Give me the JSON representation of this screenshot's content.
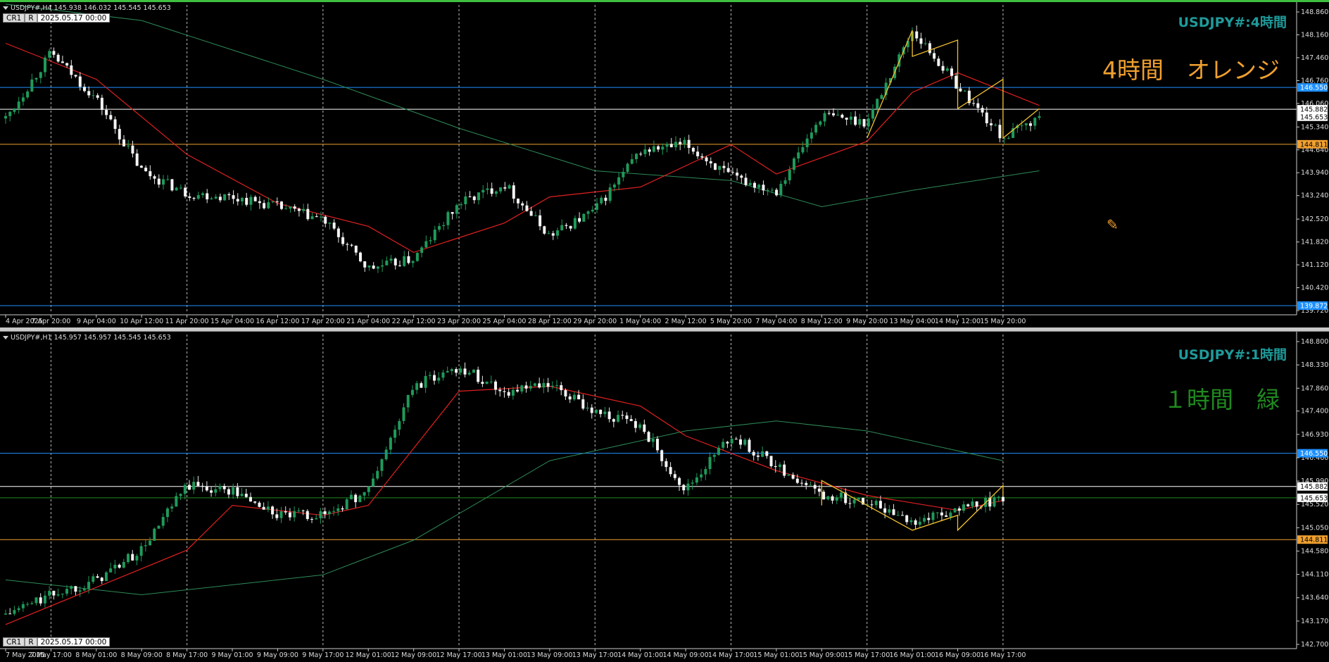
{
  "panes": [
    {
      "id": "h4",
      "info_text": "USDJPY#,H4  145.938 146.032 145.545 145.653",
      "date_flag": "2025.05.17 00:00",
      "cr_label": "CR1",
      "r_label": "R",
      "symbol_label": "USDJPY#:4時間",
      "note": "4時間　オレンジ",
      "note_color": "#f0a030",
      "price_axis": [
        "148.860",
        "148.160",
        "147.460",
        "146.760",
        "146.060",
        "145.340",
        "144.640",
        "143.940",
        "143.240",
        "142.520",
        "141.820",
        "141.120",
        "140.420",
        "139.720"
      ],
      "price_tags": [
        {
          "label": "146.550",
          "value": 146.55,
          "bg": "#1e90ff",
          "fg": "#fff"
        },
        {
          "label": "145.882",
          "value": 145.882,
          "bg": "#ffffff",
          "fg": "#000"
        },
        {
          "label": "145.653",
          "value": 145.653,
          "bg": "#ffffff",
          "fg": "#000"
        },
        {
          "label": "144.811",
          "value": 144.811,
          "bg": "#f0a030",
          "fg": "#000"
        },
        {
          "label": "139.872",
          "value": 139.872,
          "bg": "#1e90ff",
          "fg": "#fff"
        }
      ],
      "time_axis": [
        "4 Apr 2025",
        "7 Apr 20:00",
        "9 Apr 04:00",
        "10 Apr 12:00",
        "11 Apr 20:00",
        "15 Apr 04:00",
        "16 Apr 12:00",
        "17 Apr 20:00",
        "21 Apr 04:00",
        "22 Apr 12:00",
        "23 Apr 20:00",
        "25 Apr 04:00",
        "28 Apr 12:00",
        "29 Apr 20:00",
        "1 May 04:00",
        "2 May 12:00",
        "5 May 20:00",
        "7 May 04:00",
        "8 May 12:00",
        "9 May 20:00",
        "13 May 04:00",
        "14 May 12:00",
        "15 May 20:00"
      ]
    },
    {
      "id": "h1",
      "info_text": "USDJPY#,H1  145.957 145.957 145.545 145.653",
      "date_flag": "2025.05.17 00:00",
      "cr_label": "CR1",
      "r_label": "R",
      "symbol_label": "USDJPY#:1時間",
      "note": "１時間　緑",
      "note_color": "#1f8a1f",
      "price_axis": [
        "148.800",
        "148.330",
        "147.860",
        "147.400",
        "146.930",
        "146.460",
        "145.990",
        "145.520",
        "145.050",
        "144.580",
        "144.110",
        "143.640",
        "143.170",
        "142.700"
      ],
      "price_tags": [
        {
          "label": "146.550",
          "value": 146.55,
          "bg": "#1e90ff",
          "fg": "#fff"
        },
        {
          "label": "145.882",
          "value": 145.882,
          "bg": "#ffffff",
          "fg": "#000"
        },
        {
          "label": "145.653",
          "value": 145.653,
          "bg": "#ffffff",
          "fg": "#000"
        },
        {
          "label": "144.811",
          "value": 144.811,
          "bg": "#f0a030",
          "fg": "#000"
        }
      ],
      "time_axis": [
        "7 May 2025",
        "7 May 17:00",
        "8 May 01:00",
        "8 May 09:00",
        "8 May 17:00",
        "9 May 01:00",
        "9 May 09:00",
        "9 May 17:00",
        "12 May 01:00",
        "12 May 09:00",
        "12 May 17:00",
        "13 May 01:00",
        "13 May 09:00",
        "13 May 17:00",
        "14 May 01:00",
        "14 May 09:00",
        "14 May 17:00",
        "15 May 01:00",
        "15 May 09:00",
        "15 May 17:00",
        "16 May 01:00",
        "16 May 09:00",
        "16 May 17:00"
      ]
    }
  ],
  "chart_data": [
    {
      "type": "candlestick",
      "title": "USDJPY#,H4",
      "ylim": [
        139.72,
        148.86
      ],
      "horizontal_levels": [
        {
          "value": 146.55,
          "color": "#1e90ff"
        },
        {
          "value": 145.882,
          "color": "#ffffff"
        },
        {
          "value": 144.811,
          "color": "#f0a030"
        },
        {
          "value": 139.872,
          "color": "#1e90ff"
        }
      ],
      "close_path": [
        {
          "x": "4 Apr 2025",
          "y": 145.6
        },
        {
          "x": "7 Apr 20:00",
          "y": 147.6
        },
        {
          "x": "9 Apr 04:00",
          "y": 146.2
        },
        {
          "x": "10 Apr 12:00",
          "y": 144.0
        },
        {
          "x": "11 Apr 20:00",
          "y": 143.3
        },
        {
          "x": "15 Apr 04:00",
          "y": 143.2
        },
        {
          "x": "16 Apr 12:00",
          "y": 142.9
        },
        {
          "x": "17 Apr 20:00",
          "y": 142.5
        },
        {
          "x": "21 Apr 04:00",
          "y": 141.0
        },
        {
          "x": "22 Apr 12:00",
          "y": 141.3
        },
        {
          "x": "23 Apr 20:00",
          "y": 143.0
        },
        {
          "x": "25 Apr 04:00",
          "y": 143.6
        },
        {
          "x": "28 Apr 12:00",
          "y": 142.0
        },
        {
          "x": "29 Apr 20:00",
          "y": 142.8
        },
        {
          "x": "1 May 04:00",
          "y": 144.6
        },
        {
          "x": "2 May 12:00",
          "y": 144.8
        },
        {
          "x": "5 May 20:00",
          "y": 143.8
        },
        {
          "x": "7 May 04:00",
          "y": 143.4
        },
        {
          "x": "8 May 12:00",
          "y": 145.7
        },
        {
          "x": "9 May 20:00",
          "y": 145.5
        },
        {
          "x": "13 May 04:00",
          "y": 148.3
        },
        {
          "x": "14 May 12:00",
          "y": 146.6
        },
        {
          "x": "15 May 20:00",
          "y": 145.0
        },
        {
          "x": "16 May 20:00",
          "y": 145.653
        }
      ],
      "ma_red": [
        {
          "x": "4 Apr 2025",
          "y": 147.9
        },
        {
          "x": "9 Apr 04:00",
          "y": 146.8
        },
        {
          "x": "11 Apr 20:00",
          "y": 144.5
        },
        {
          "x": "16 Apr 12:00",
          "y": 143.0
        },
        {
          "x": "21 Apr 04:00",
          "y": 142.3
        },
        {
          "x": "22 Apr 12:00",
          "y": 141.5
        },
        {
          "x": "25 Apr 04:00",
          "y": 142.4
        },
        {
          "x": "28 Apr 12:00",
          "y": 143.2
        },
        {
          "x": "1 May 04:00",
          "y": 143.5
        },
        {
          "x": "5 May 20:00",
          "y": 144.8
        },
        {
          "x": "7 May 04:00",
          "y": 143.9
        },
        {
          "x": "9 May 20:00",
          "y": 144.9
        },
        {
          "x": "13 May 04:00",
          "y": 146.4
        },
        {
          "x": "14 May 12:00",
          "y": 147.0
        },
        {
          "x": "16 May 20:00",
          "y": 146.0
        }
      ],
      "ma_green": [
        {
          "x": "4 Apr 2025",
          "y": 149.1
        },
        {
          "x": "10 Apr 12:00",
          "y": 148.6
        },
        {
          "x": "17 Apr 20:00",
          "y": 146.8
        },
        {
          "x": "23 Apr 20:00",
          "y": 145.3
        },
        {
          "x": "29 Apr 20:00",
          "y": 144.0
        },
        {
          "x": "5 May 20:00",
          "y": 143.7
        },
        {
          "x": "8 May 12:00",
          "y": 142.9
        },
        {
          "x": "13 May 04:00",
          "y": 143.4
        },
        {
          "x": "16 May 20:00",
          "y": 144.0
        }
      ],
      "zigzag": [
        {
          "x": "9 May 20:00",
          "y": 145.0
        },
        {
          "x": "13 May 04:00",
          "y": 148.3
        },
        {
          "x": "13 May 04:00",
          "y": 147.5
        },
        {
          "x": "14 May 12:00",
          "y": 148.0
        },
        {
          "x": "14 May 12:00",
          "y": 145.9
        },
        {
          "x": "15 May 20:00",
          "y": 146.8
        },
        {
          "x": "15 May 20:00",
          "y": 145.0
        },
        {
          "x": "16 May 20:00",
          "y": 145.9
        }
      ]
    },
    {
      "type": "candlestick",
      "title": "USDJPY#,H1",
      "ylim": [
        142.7,
        148.8
      ],
      "horizontal_levels": [
        {
          "value": 146.55,
          "color": "#1e90ff"
        },
        {
          "value": 145.882,
          "color": "#ffffff"
        },
        {
          "value": 145.653,
          "color": "#1f8a1f"
        },
        {
          "value": 144.811,
          "color": "#f0a030"
        }
      ],
      "close_path": [
        {
          "x": "7 May 2025",
          "y": 143.3
        },
        {
          "x": "7 May 17:00",
          "y": 143.7
        },
        {
          "x": "8 May 01:00",
          "y": 144.0
        },
        {
          "x": "8 May 09:00",
          "y": 144.6
        },
        {
          "x": "8 May 17:00",
          "y": 145.9
        },
        {
          "x": "9 May 01:00",
          "y": 145.8
        },
        {
          "x": "9 May 09:00",
          "y": 145.3
        },
        {
          "x": "9 May 17:00",
          "y": 145.3
        },
        {
          "x": "12 May 01:00",
          "y": 145.8
        },
        {
          "x": "12 May 09:00",
          "y": 147.9
        },
        {
          "x": "12 May 17:00",
          "y": 148.3
        },
        {
          "x": "13 May 01:00",
          "y": 147.8
        },
        {
          "x": "13 May 09:00",
          "y": 147.9
        },
        {
          "x": "13 May 17:00",
          "y": 147.4
        },
        {
          "x": "14 May 01:00",
          "y": 147.1
        },
        {
          "x": "14 May 09:00",
          "y": 145.8
        },
        {
          "x": "14 May 17:00",
          "y": 146.9
        },
        {
          "x": "15 May 01:00",
          "y": 146.3
        },
        {
          "x": "15 May 09:00",
          "y": 145.7
        },
        {
          "x": "15 May 17:00",
          "y": 145.6
        },
        {
          "x": "16 May 01:00",
          "y": 145.2
        },
        {
          "x": "16 May 09:00",
          "y": 145.4
        },
        {
          "x": "16 May 17:00",
          "y": 145.653
        }
      ],
      "ma_red": [
        {
          "x": "7 May 2025",
          "y": 143.1
        },
        {
          "x": "8 May 17:00",
          "y": 144.6
        },
        {
          "x": "9 May 01:00",
          "y": 145.5
        },
        {
          "x": "9 May 17:00",
          "y": 145.3
        },
        {
          "x": "12 May 01:00",
          "y": 145.5
        },
        {
          "x": "12 May 17:00",
          "y": 147.8
        },
        {
          "x": "13 May 09:00",
          "y": 147.9
        },
        {
          "x": "14 May 01:00",
          "y": 147.5
        },
        {
          "x": "14 May 09:00",
          "y": 146.9
        },
        {
          "x": "15 May 01:00",
          "y": 146.2
        },
        {
          "x": "15 May 17:00",
          "y": 145.7
        },
        {
          "x": "16 May 09:00",
          "y": 145.4
        },
        {
          "x": "16 May 17:00",
          "y": 145.6
        }
      ],
      "ma_green": [
        {
          "x": "7 May 2025",
          "y": 144.0
        },
        {
          "x": "8 May 09:00",
          "y": 143.7
        },
        {
          "x": "9 May 17:00",
          "y": 144.1
        },
        {
          "x": "12 May 09:00",
          "y": 144.8
        },
        {
          "x": "13 May 09:00",
          "y": 146.4
        },
        {
          "x": "14 May 09:00",
          "y": 147.0
        },
        {
          "x": "15 May 01:00",
          "y": 147.2
        },
        {
          "x": "15 May 17:00",
          "y": 147.0
        },
        {
          "x": "16 May 17:00",
          "y": 146.4
        }
      ],
      "zigzag": [
        {
          "x": "15 May 09:00",
          "y": 145.5
        },
        {
          "x": "15 May 09:00",
          "y": 146.0
        },
        {
          "x": "15 May 17:00",
          "y": 145.5
        },
        {
          "x": "16 May 01:00",
          "y": 145.0
        },
        {
          "x": "16 May 09:00",
          "y": 145.3
        },
        {
          "x": "16 May 09:00",
          "y": 145.0
        },
        {
          "x": "16 May 17:00",
          "y": 145.9
        },
        {
          "x": "16 May 17:00",
          "y": 145.7
        }
      ]
    }
  ]
}
